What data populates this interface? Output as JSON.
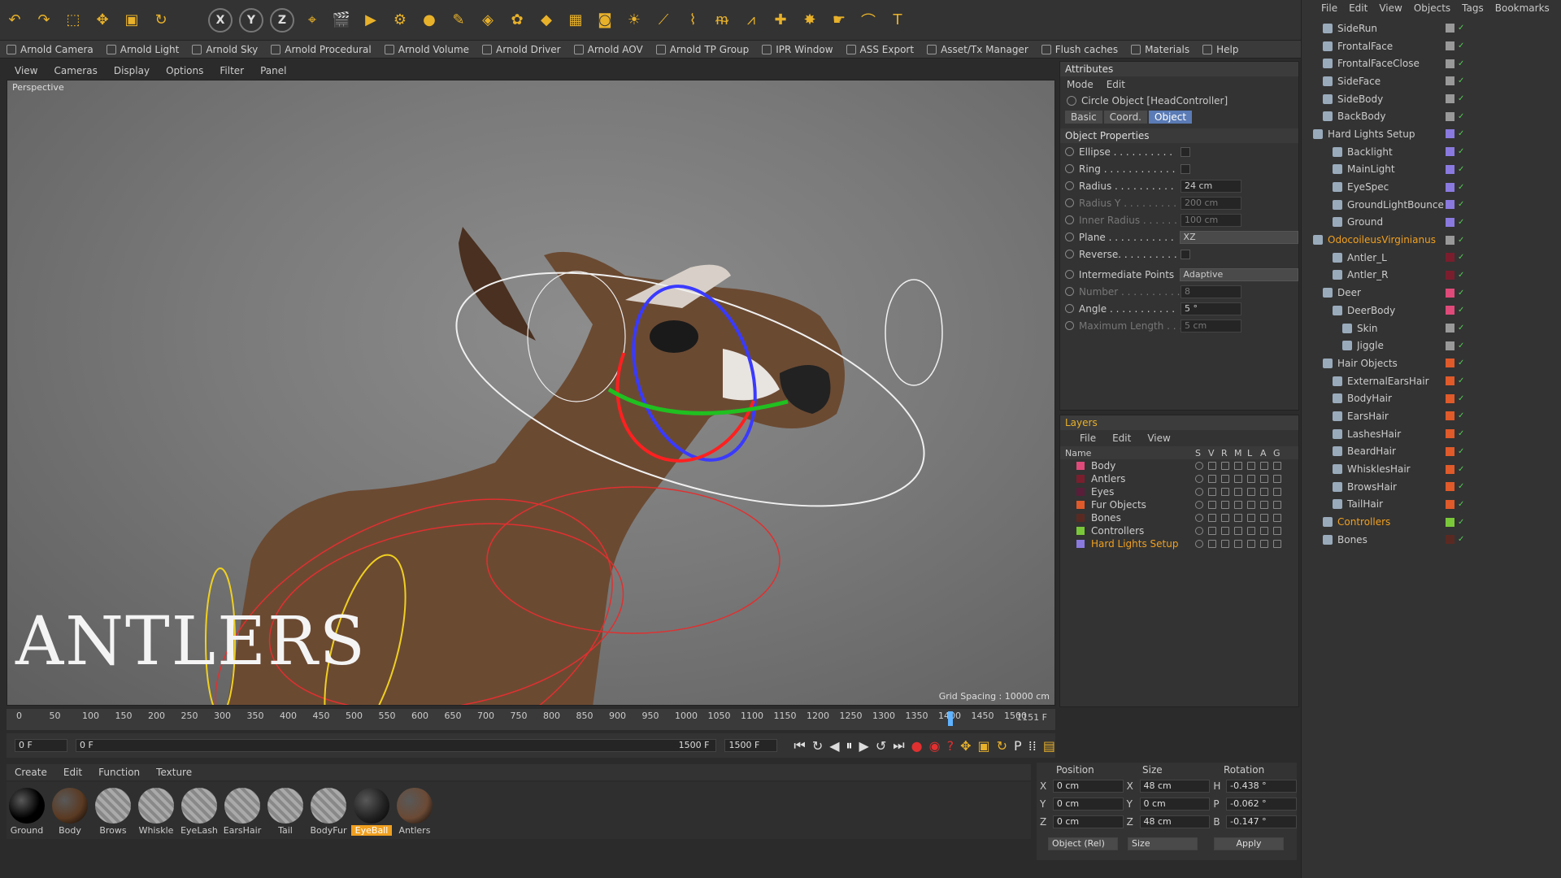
{
  "toolbar": {
    "icons": [
      "undo-icon",
      "redo-icon",
      "live-select-icon",
      "move-icon",
      "scale-icon",
      "rotate-icon",
      "blank",
      "x-axis",
      "y-axis",
      "z-axis",
      "coordinate-icon",
      "render-view-icon",
      "render-picture-viewer-icon",
      "render-settings-icon",
      "sphere-icon",
      "pen-icon",
      "cube-icon",
      "array-icon",
      "deformer-icon",
      "floor-icon",
      "camera-icon",
      "light-icon",
      "brush-icon",
      "sculpt-icon",
      "hair-icon",
      "guide-icon",
      "joint-icon",
      "bone-icon",
      "pose-icon",
      "curve-icon",
      "text-icon"
    ],
    "axes": [
      "X",
      "Y",
      "Z"
    ],
    "text_tool": "T"
  },
  "arnold": [
    "Arnold Camera",
    "Arnold Light",
    "Arnold Sky",
    "Arnold Procedural",
    "Arnold Volume",
    "Arnold Driver",
    "Arnold AOV",
    "Arnold TP Group",
    "IPR Window",
    "ASS Export",
    "Asset/Tx Manager",
    "Flush caches",
    "Materials",
    "Help"
  ],
  "viewport": {
    "menu": [
      "View",
      "Cameras",
      "Display",
      "Options",
      "Filter",
      "Panel"
    ],
    "label": "Perspective",
    "grid": "Grid Spacing : 10000 cm",
    "overlay_title": "ANTLERS"
  },
  "timeline": {
    "ticks": [
      "0",
      "50",
      "100",
      "150",
      "200",
      "250",
      "300",
      "350",
      "400",
      "450",
      "500",
      "550",
      "600",
      "650",
      "700",
      "750",
      "800",
      "850",
      "900",
      "950",
      "1000",
      "1050",
      "1100",
      "1150",
      "1200",
      "1250",
      "1300",
      "1350",
      "1400",
      "1450",
      "1500"
    ],
    "current": "1151 F",
    "start": "0 F",
    "range_start": "0 F",
    "range_end": "1500 F",
    "end": "1500 F"
  },
  "materials": {
    "menu": [
      "Create",
      "Edit",
      "Function",
      "Texture"
    ],
    "items": [
      {
        "name": "Ground",
        "color": "#000000"
      },
      {
        "name": "Body",
        "color": "#5a3a22"
      },
      {
        "name": "Brows",
        "color": "#9a9a9a"
      },
      {
        "name": "Whiskle",
        "color": "#9a9a9a"
      },
      {
        "name": "EyeLash",
        "color": "#9a9a9a"
      },
      {
        "name": "EarsHair",
        "color": "#9a9a9a"
      },
      {
        "name": "Tail",
        "color": "#9a9a9a"
      },
      {
        "name": "BodyFur",
        "color": "#9a9a9a"
      },
      {
        "name": "EyeBall",
        "color": "#222222"
      },
      {
        "name": "Antlers",
        "color": "#6b4a35"
      }
    ],
    "selected": "EyeBall"
  },
  "coords": {
    "headers": [
      "Position",
      "Size",
      "Rotation"
    ],
    "rows": [
      {
        "a": "X",
        "p": "0 cm",
        "s": "48 cm",
        "r": "H",
        "rv": "-0.438 °"
      },
      {
        "a": "Y",
        "p": "0 cm",
        "s": "0 cm",
        "r": "P",
        "rv": "-0.062 °"
      },
      {
        "a": "Z",
        "p": "0 cm",
        "s": "48 cm",
        "r": "B",
        "rv": "-0.147 °"
      }
    ],
    "mode": "Object (Rel)",
    "size_mode": "Size",
    "apply": "Apply"
  },
  "attributes": {
    "title": "Attributes",
    "menu": [
      "Mode",
      "Edit"
    ],
    "object": "Circle Object [HeadController]",
    "tabs": [
      "Basic",
      "Coord.",
      "Object"
    ],
    "active_tab": "Object",
    "section": "Object Properties",
    "props": [
      {
        "label": "Ellipse . . . . . . . . . .",
        "type": "cb"
      },
      {
        "label": "Ring . . . . . . . . . . . .",
        "type": "cb"
      },
      {
        "label": "Radius . . . . . . . . . .",
        "type": "val",
        "value": "24 cm"
      },
      {
        "label": "Radius Y . . . . . . . . .",
        "type": "val",
        "value": "200 cm",
        "dis": true
      },
      {
        "label": "Inner Radius . . . . . .",
        "type": "val",
        "value": "100 cm",
        "dis": true
      },
      {
        "label": "Plane . . . . . . . . . . .",
        "type": "dd",
        "value": "XZ"
      },
      {
        "label": "Reverse. . . . . . . . . .",
        "type": "cb"
      },
      {
        "label": "Intermediate Points",
        "type": "dd",
        "value": "Adaptive"
      },
      {
        "label": "Number . . . . . . . . . .",
        "type": "val",
        "value": "8",
        "dis": true
      },
      {
        "label": "Angle . . . . . . . . . . .",
        "type": "val",
        "value": "5 °"
      },
      {
        "label": "Maximum Length . . .",
        "type": "val",
        "value": "5 cm",
        "dis": true
      }
    ]
  },
  "layers": {
    "title": "Layers",
    "menu": [
      "File",
      "Edit",
      "View"
    ],
    "cols": [
      "Name",
      "S",
      "V",
      "R",
      "M",
      "L",
      "A",
      "G"
    ],
    "items": [
      {
        "name": "Body",
        "color": "#e04a7a"
      },
      {
        "name": "Antlers",
        "color": "#7a1e2e"
      },
      {
        "name": "Eyes",
        "color": "#5a1e3a"
      },
      {
        "name": "Fur Objects",
        "color": "#e05a2a"
      },
      {
        "name": "Bones",
        "color": "#5a2a22"
      },
      {
        "name": "Controllers",
        "color": "#7ac83a"
      },
      {
        "name": "Hard Lights Setup",
        "color": "#8a7ae0",
        "highlight": true
      }
    ]
  },
  "objects": {
    "menu": [
      "File",
      "Edit",
      "View",
      "Objects",
      "Tags",
      "Bookmarks"
    ],
    "items": [
      {
        "name": "SideRun",
        "indent": 1,
        "tag": "#999"
      },
      {
        "name": "FrontalFace",
        "indent": 1,
        "tag": "#999"
      },
      {
        "name": "FrontalFaceClose",
        "indent": 1,
        "tag": "#999"
      },
      {
        "name": "SideFace",
        "indent": 1,
        "tag": "#999"
      },
      {
        "name": "SideBody",
        "indent": 1,
        "tag": "#999"
      },
      {
        "name": "BackBody",
        "indent": 1,
        "tag": "#999"
      },
      {
        "name": "Hard Lights Setup",
        "indent": 0,
        "tag": "#8a7ae0"
      },
      {
        "name": "Backlight",
        "indent": 2,
        "tag": "#8a7ae0"
      },
      {
        "name": "MainLight",
        "indent": 2,
        "tag": "#8a7ae0"
      },
      {
        "name": "EyeSpec",
        "indent": 2,
        "tag": "#8a7ae0"
      },
      {
        "name": "GroundLightBounce",
        "indent": 2,
        "tag": "#8a7ae0"
      },
      {
        "name": "Ground",
        "indent": 2,
        "tag": "#8a7ae0"
      },
      {
        "name": "OdocoileusVirginianus",
        "indent": 0,
        "tag": "#999",
        "orange": true
      },
      {
        "name": "Antler_L",
        "indent": 2,
        "tag": "#7a1e2e"
      },
      {
        "name": "Antler_R",
        "indent": 2,
        "tag": "#7a1e2e"
      },
      {
        "name": "Deer",
        "indent": 1,
        "tag": "#e04a7a"
      },
      {
        "name": "DeerBody",
        "indent": 2,
        "tag": "#e04a7a"
      },
      {
        "name": "Skin",
        "indent": 3,
        "tag": "#999"
      },
      {
        "name": "Jiggle",
        "indent": 3,
        "tag": "#999"
      },
      {
        "name": "Hair Objects",
        "indent": 1,
        "tag": "#e05a2a"
      },
      {
        "name": "ExternalEarsHair",
        "indent": 2,
        "tag": "#e05a2a"
      },
      {
        "name": "BodyHair",
        "indent": 2,
        "tag": "#e05a2a"
      },
      {
        "name": "EarsHair",
        "indent": 2,
        "tag": "#e05a2a"
      },
      {
        "name": "LashesHair",
        "indent": 2,
        "tag": "#e05a2a"
      },
      {
        "name": "BeardHair",
        "indent": 2,
        "tag": "#e05a2a"
      },
      {
        "name": "WhisklesHair",
        "indent": 2,
        "tag": "#e05a2a"
      },
      {
        "name": "BrowsHair",
        "indent": 2,
        "tag": "#e05a2a"
      },
      {
        "name": "TailHair",
        "indent": 2,
        "tag": "#e05a2a"
      },
      {
        "name": "Controllers",
        "indent": 1,
        "tag": "#7ac83a",
        "orange": true
      },
      {
        "name": "Bones",
        "indent": 1,
        "tag": "#5a2a22"
      }
    ]
  }
}
